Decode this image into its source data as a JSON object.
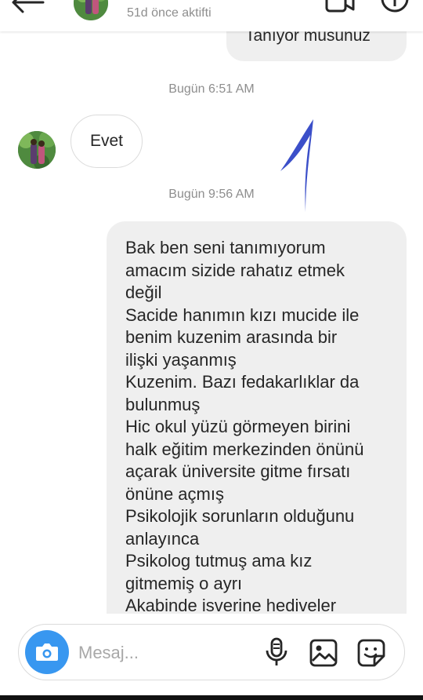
{
  "header": {
    "status": "51d önce aktifti",
    "icons": [
      "back-arrow-icon",
      "video-call-icon",
      "info-icon"
    ]
  },
  "messages": {
    "top_partial": "Tanıyor musunuz",
    "timestamp_1": "Bugün 6:51 AM",
    "incoming": "Evet",
    "timestamp_2": "Bugün 9:56 AM",
    "outgoing": "Bak ben seni tanımıyorum\namacım sizide rahatız etmek\ndeğil\nSacide hanımın kızı mucide ile\nbenim kuzenim arasında bir\nilişki yaşanmış\nKuzenim. Bazı fedakarlıklar da\nbulunmuş\nHic okul yüzü görmeyen birini\nhalk eğitim merkezinden önünü\naçarak üniversite gitme fırsatı\nönüne açmış\nPsikolojik  sorunların olduğunu\nanlayınca\nPsikolog tutmuş ama kız\ngitmemiş o ayrı\nAkabinde isverine hediveler"
  },
  "composer": {
    "placeholder": "Mesaj..."
  },
  "colors": {
    "accent": "#3897f0",
    "bubble_gray": "#efefef",
    "muted_text": "#8e8e8e",
    "annotation_blue": "#3b4fc9"
  }
}
